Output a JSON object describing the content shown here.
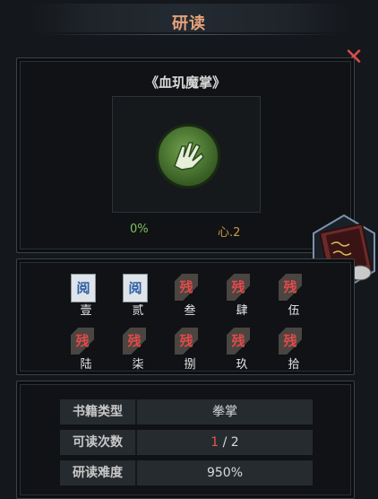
{
  "header": {
    "title": "研读"
  },
  "book": {
    "name": "《血玑魔掌》",
    "progress": "0%",
    "heart": "心.2"
  },
  "chapters": [
    {
      "num": "壹",
      "status": "read",
      "seal": "阅"
    },
    {
      "num": "贰",
      "status": "read",
      "seal": "阅"
    },
    {
      "num": "叁",
      "status": "broken",
      "seal": "残"
    },
    {
      "num": "肆",
      "status": "broken",
      "seal": "残"
    },
    {
      "num": "伍",
      "status": "broken",
      "seal": "残"
    },
    {
      "num": "陆",
      "status": "broken",
      "seal": "残"
    },
    {
      "num": "柒",
      "status": "broken",
      "seal": "残"
    },
    {
      "num": "捌",
      "status": "broken",
      "seal": "残"
    },
    {
      "num": "玖",
      "status": "broken",
      "seal": "残"
    },
    {
      "num": "拾",
      "status": "broken",
      "seal": "残"
    }
  ],
  "info": {
    "type_label": "书籍类型",
    "type_value": "拳掌",
    "count_label": "可读次数",
    "count_current": "1",
    "count_total": " / 2",
    "difficulty_label": "研读难度",
    "difficulty_value": "950%"
  },
  "colors": {
    "title": "#e5a27a",
    "progress": "#7cc25b",
    "heart": "#c99a46",
    "broken_seal": "#e24a4a",
    "read_seal": "#2d5ea3"
  },
  "icons": {
    "close": "close-icon",
    "art": "palm-icon",
    "side": "book-badge-icon"
  }
}
